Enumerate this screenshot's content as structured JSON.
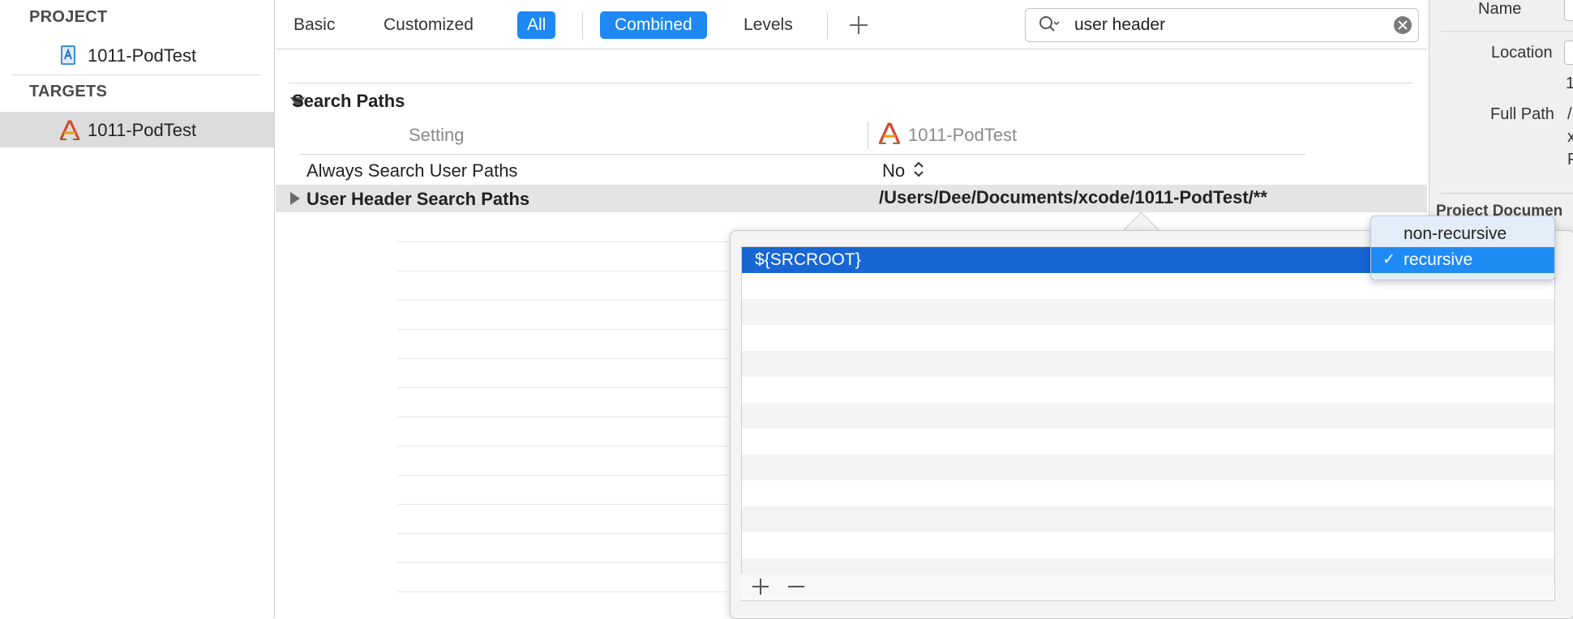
{
  "navigator": {
    "project_section": "PROJECT",
    "project_item": "1011-PodTest",
    "targets_section": "TARGETS",
    "target_item": "1011-PodTest"
  },
  "tabs": {
    "basic": "Basic",
    "customized": "Customized",
    "all": "All",
    "combined": "Combined",
    "levels": "Levels"
  },
  "search": {
    "value": "user header"
  },
  "settings": {
    "section_title": "Search Paths",
    "column_setting": "Setting",
    "column_target": "1011-PodTest",
    "rows": [
      {
        "name": "Always Search User Paths",
        "value": "No"
      },
      {
        "name": "User Header Search Paths",
        "value": "/Users/Dee/Documents/xcode/1011-PodTest/**"
      }
    ]
  },
  "popover": {
    "entries": [
      "${SRCROOT}"
    ]
  },
  "recursion_menu": {
    "options": [
      "non-recursive",
      "recursive"
    ],
    "selected": "recursive",
    "checkmark": "✓"
  },
  "inspector": {
    "name_label": "Name",
    "location_label": "Location",
    "full_path_label": "Full Path",
    "fragment_1": "1",
    "fragment_2": "/",
    "fragment_3": "x",
    "fragment_4": "P",
    "section_header": "Project Documen"
  },
  "colors": {
    "accent": "#1e88f5",
    "selection": "#1766d4",
    "selected_row": "#e4e4e4"
  }
}
